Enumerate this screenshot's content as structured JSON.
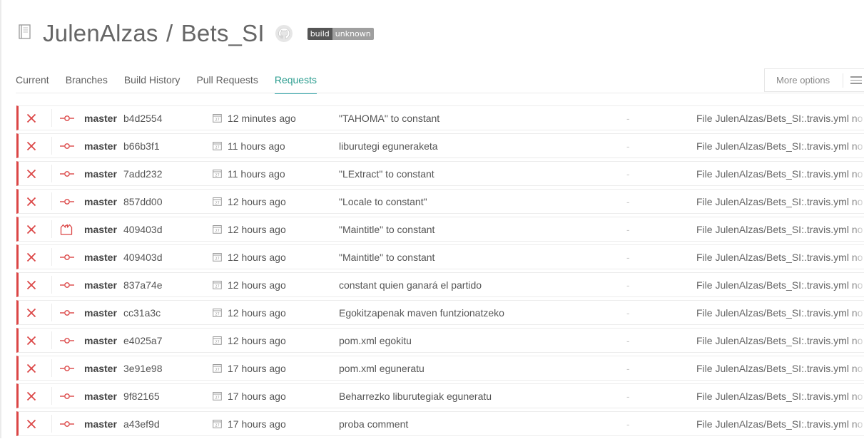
{
  "header": {
    "owner": "JulenAlzas",
    "separator": "/",
    "repo": "Bets_SI",
    "badge_label": "build",
    "badge_value": "unknown"
  },
  "tabs": [
    {
      "label": "Current",
      "active": false
    },
    {
      "label": "Branches",
      "active": false
    },
    {
      "label": "Build History",
      "active": false
    },
    {
      "label": "Pull Requests",
      "active": false
    },
    {
      "label": "Requests",
      "active": true
    }
  ],
  "more_options": {
    "label": "More options",
    "icon": "hamburger-menu-icon"
  },
  "colors": {
    "failed": "#db4545",
    "accent": "#2b9d8f"
  },
  "requests": [
    {
      "status": "failed",
      "type": "push",
      "branch": "master",
      "sha": "b4d2554",
      "time": "12 minutes ago",
      "message": "\"TAHOMA\" to constant",
      "dash": "-",
      "result": "File JulenAlzas/Bets_SI:.travis.yml no"
    },
    {
      "status": "failed",
      "type": "push",
      "branch": "master",
      "sha": "b66b3f1",
      "time": "11 hours ago",
      "message": "liburutegi eguneraketa",
      "dash": "-",
      "result": "File JulenAlzas/Bets_SI:.travis.yml no"
    },
    {
      "status": "failed",
      "type": "push",
      "branch": "master",
      "sha": "7add232",
      "time": "11 hours ago",
      "message": "\"LExtract\" to constant",
      "dash": "-",
      "result": "File JulenAlzas/Bets_SI:.travis.yml no"
    },
    {
      "status": "failed",
      "type": "push",
      "branch": "master",
      "sha": "857dd00",
      "time": "12 hours ago",
      "message": "\"Locale to constant\"",
      "dash": "-",
      "result": "File JulenAlzas/Bets_SI:.travis.yml no"
    },
    {
      "status": "failed",
      "type": "api",
      "branch": "master",
      "sha": "409403d",
      "time": "12 hours ago",
      "message": "\"Maintitle\" to constant",
      "dash": "-",
      "result": "File JulenAlzas/Bets_SI:.travis.yml no"
    },
    {
      "status": "failed",
      "type": "push",
      "branch": "master",
      "sha": "409403d",
      "time": "12 hours ago",
      "message": "\"Maintitle\" to constant",
      "dash": "-",
      "result": "File JulenAlzas/Bets_SI:.travis.yml no"
    },
    {
      "status": "failed",
      "type": "push",
      "branch": "master",
      "sha": "837a74e",
      "time": "12 hours ago",
      "message": "constant quien ganará el partido",
      "dash": "-",
      "result": "File JulenAlzas/Bets_SI:.travis.yml no"
    },
    {
      "status": "failed",
      "type": "push",
      "branch": "master",
      "sha": "cc31a3c",
      "time": "12 hours ago",
      "message": "Egokitzapenak maven funtzionatzeko",
      "dash": "-",
      "result": "File JulenAlzas/Bets_SI:.travis.yml no"
    },
    {
      "status": "failed",
      "type": "push",
      "branch": "master",
      "sha": "e4025a7",
      "time": "12 hours ago",
      "message": "pom.xml egokitu",
      "dash": "-",
      "result": "File JulenAlzas/Bets_SI:.travis.yml no"
    },
    {
      "status": "failed",
      "type": "push",
      "branch": "master",
      "sha": "3e91e98",
      "time": "17 hours ago",
      "message": "pom.xml eguneratu",
      "dash": "-",
      "result": "File JulenAlzas/Bets_SI:.travis.yml no"
    },
    {
      "status": "failed",
      "type": "push",
      "branch": "master",
      "sha": "9f82165",
      "time": "17 hours ago",
      "message": "Beharrezko liburutegiak eguneratu",
      "dash": "-",
      "result": "File JulenAlzas/Bets_SI:.travis.yml no"
    },
    {
      "status": "failed",
      "type": "push",
      "branch": "master",
      "sha": "a43ef9d",
      "time": "17 hours ago",
      "message": "proba comment",
      "dash": "-",
      "result": "File JulenAlzas/Bets_SI:.travis.yml no"
    }
  ]
}
